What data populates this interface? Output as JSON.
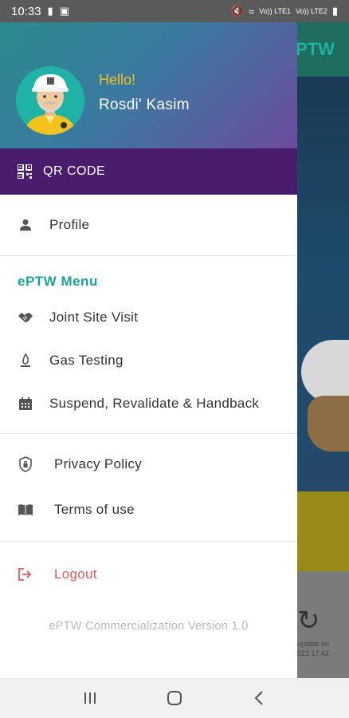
{
  "status_bar": {
    "time": "10:33",
    "signal_text_1": "Vo)) LTE1",
    "signal_text_2": "Vo)) LTE2"
  },
  "background_app": {
    "header_title_partial": "PTW",
    "card_text_1": "update on",
    "card_text_2": "021 17:42"
  },
  "drawer": {
    "greeting": "Hello!",
    "user_name": "Rosdi' Kasim",
    "qr_label": "QR CODE",
    "profile_label": "Profile",
    "section_title": "ePTW Menu",
    "menu_items": [
      {
        "label": "Joint Site Visit",
        "icon": "handshake-icon"
      },
      {
        "label": "Gas Testing",
        "icon": "flame-icon"
      },
      {
        "label": "Suspend, Revalidate & Handback",
        "icon": "calendar-icon"
      }
    ],
    "privacy_label": "Privacy Policy",
    "terms_label": "Terms of use",
    "logout_label": "Logout",
    "version_text": "ePTW Commercialization Version 1.0"
  },
  "colors": {
    "qr_bar": "#4a1c6c",
    "accent": "#1aa39a",
    "greeting": "#f4c21d",
    "logout": "#e05b5b"
  }
}
